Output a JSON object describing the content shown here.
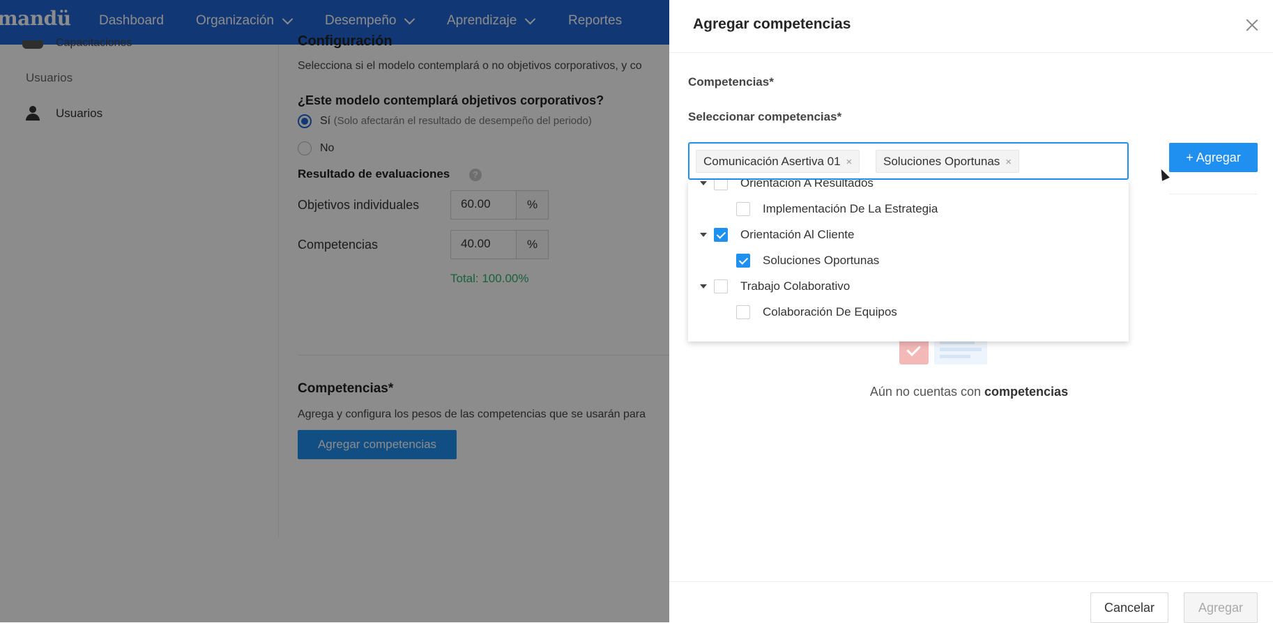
{
  "app": {
    "logo": "mandü"
  },
  "nav": {
    "items": [
      {
        "label": "Dashboard",
        "has_menu": false
      },
      {
        "label": "Organización",
        "has_menu": true
      },
      {
        "label": "Desempeño",
        "has_menu": true
      },
      {
        "label": "Aprendizaje",
        "has_menu": true
      },
      {
        "label": "Reportes",
        "has_menu": false
      }
    ]
  },
  "sidebar": {
    "top_item": "Capacitaciones",
    "section": "Usuarios",
    "items": [
      {
        "label": "Usuarios",
        "icon": "user-icon"
      }
    ]
  },
  "main": {
    "config_title": "Configuración",
    "config_description": "Selecciona si el modelo contemplará o no objetivos corporativos, y co",
    "question": "¿Este modelo contemplará objetivos corporativos?",
    "options": [
      {
        "label": "Sí",
        "note": "(Solo afectarán el resultado de desempeño del periodo)",
        "checked": true
      },
      {
        "label": "No",
        "checked": false
      }
    ],
    "results_title": "Resultado de evaluaciones",
    "rows": [
      {
        "label": "Objetivos individuales",
        "value": "60.00",
        "unit": "%"
      },
      {
        "label": "Competencias",
        "value": "40.00",
        "unit": "%"
      }
    ],
    "total": "Total: 100.00%",
    "competencias_title": "Competencias*",
    "competencias_description": "Agrega y configura los pesos de las competencias que se usarán para",
    "add_button": "Agregar competencias"
  },
  "drawer": {
    "title": "Agregar competencias",
    "section_label": "Competencias*",
    "select_label": "Seleccionar competencias*",
    "selected_tags": [
      "Comunicación Asertiva 01",
      "Soluciones Oportunas"
    ],
    "tag_remove": "×",
    "add_button": "+ Agregar",
    "tree": [
      {
        "label": "Orientación A Resultados",
        "level": 0,
        "checked": false,
        "expandable": true
      },
      {
        "label": "Implementación De La Estrategia",
        "level": 1,
        "checked": false,
        "expandable": false
      },
      {
        "label": "Orientación Al Cliente",
        "level": 0,
        "checked": true,
        "expandable": true
      },
      {
        "label": "Soluciones Oportunas",
        "level": 1,
        "checked": true,
        "expandable": false
      },
      {
        "label": "Trabajo Colaborativo",
        "level": 0,
        "checked": false,
        "expandable": true
      },
      {
        "label": "Colaboración De Equipos",
        "level": 1,
        "checked": false,
        "expandable": false
      }
    ],
    "empty_text_prefix": "Aún no cuentas con",
    "empty_text_bold": "competencias",
    "cancel_button": "Cancelar",
    "submit_button": "Agregar"
  },
  "colors": {
    "primary": "#1f8ff0",
    "nav": "#1f67d6",
    "success": "#2db36b"
  }
}
